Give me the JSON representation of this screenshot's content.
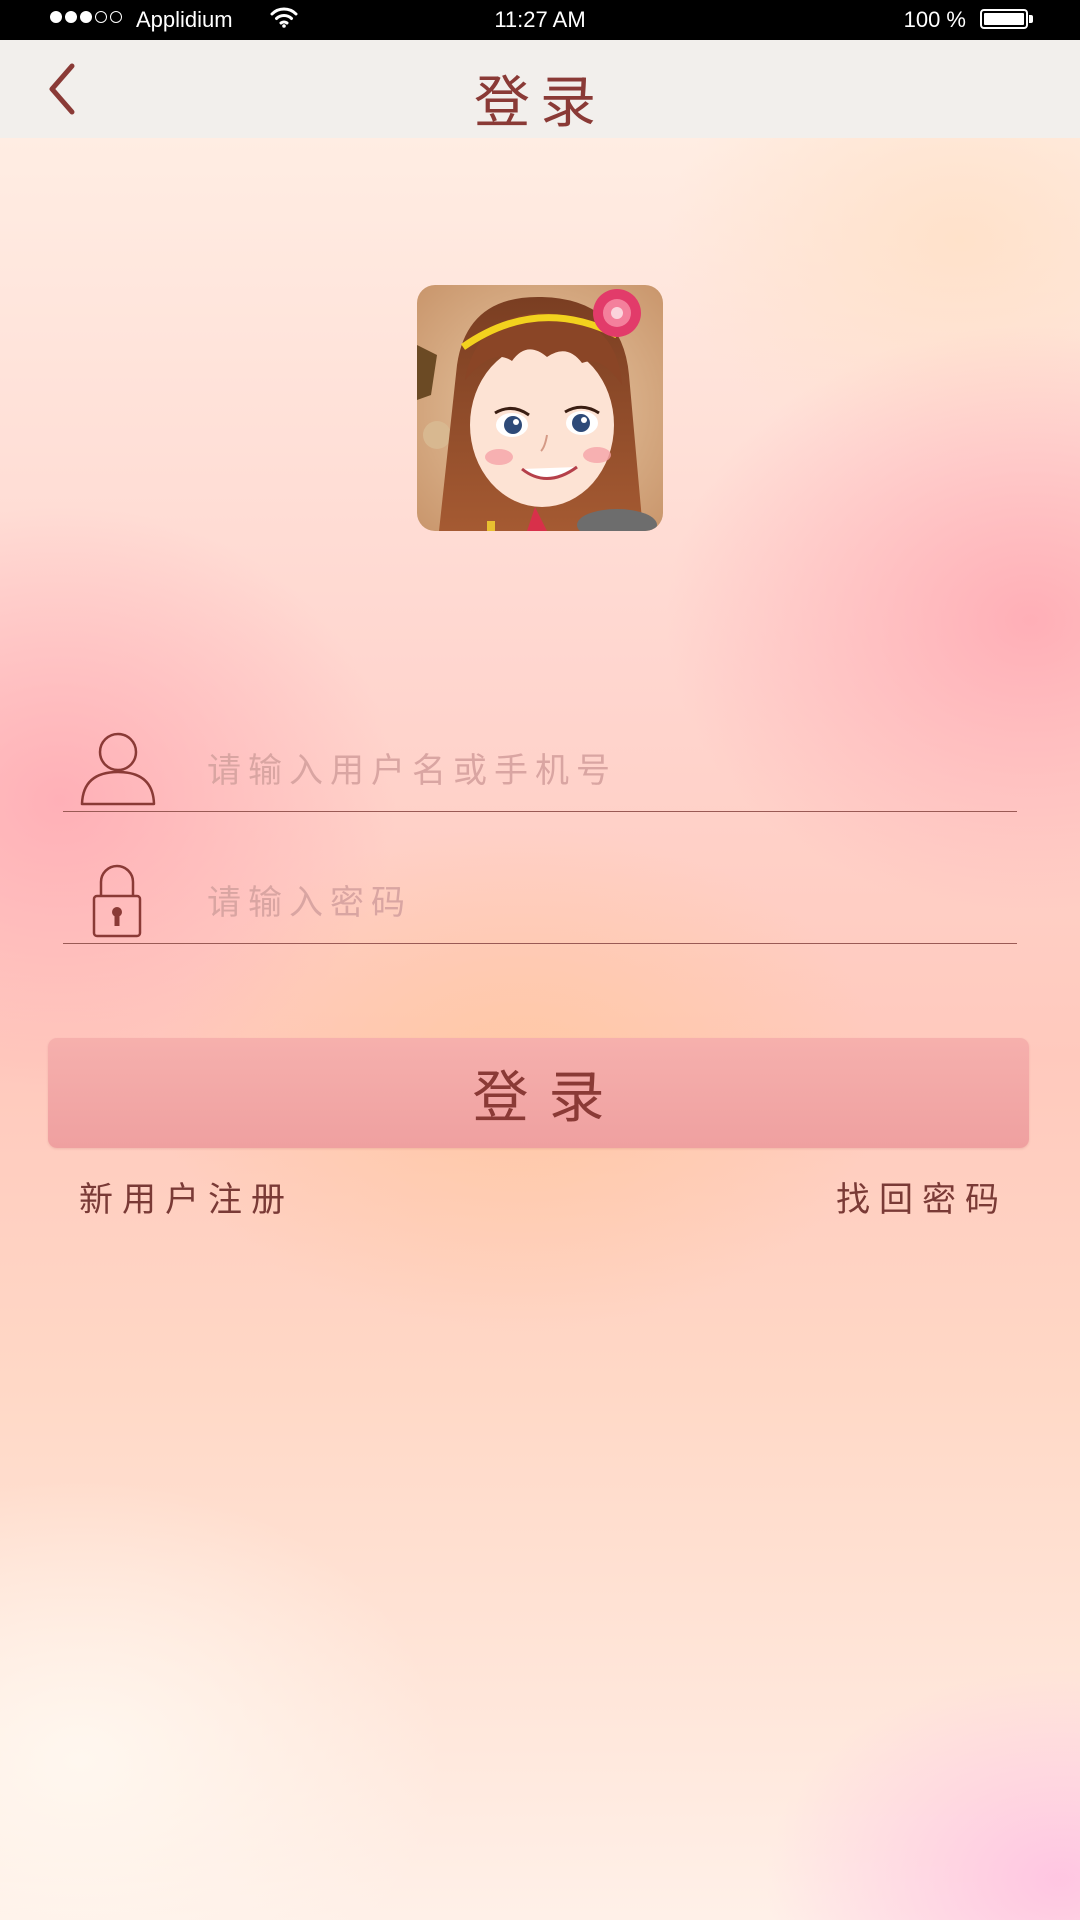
{
  "status_bar": {
    "carrier": "Applidium",
    "time": "11:27 AM",
    "battery": "100 %",
    "signal_bars_filled": 3,
    "signal_bars_total": 5,
    "battery_level": 1.0
  },
  "nav": {
    "title": "登录",
    "back_icon": "chevron-left-icon"
  },
  "avatar": {
    "icon": "cartoon-girl-avatar"
  },
  "form": {
    "username_placeholder": "请输入用户名或手机号",
    "username_value": "",
    "username_icon": "user-icon",
    "password_placeholder": "请输入密码",
    "password_value": "",
    "password_icon": "lock-icon"
  },
  "login_button_label": "登录",
  "links": {
    "register": "新用户注册",
    "forgot_password": "找回密码"
  },
  "colors": {
    "accent": "#8a3a36",
    "button": "#f2a6a6",
    "nav_background": "#f2efec",
    "placeholder": "#d9a5a2"
  }
}
